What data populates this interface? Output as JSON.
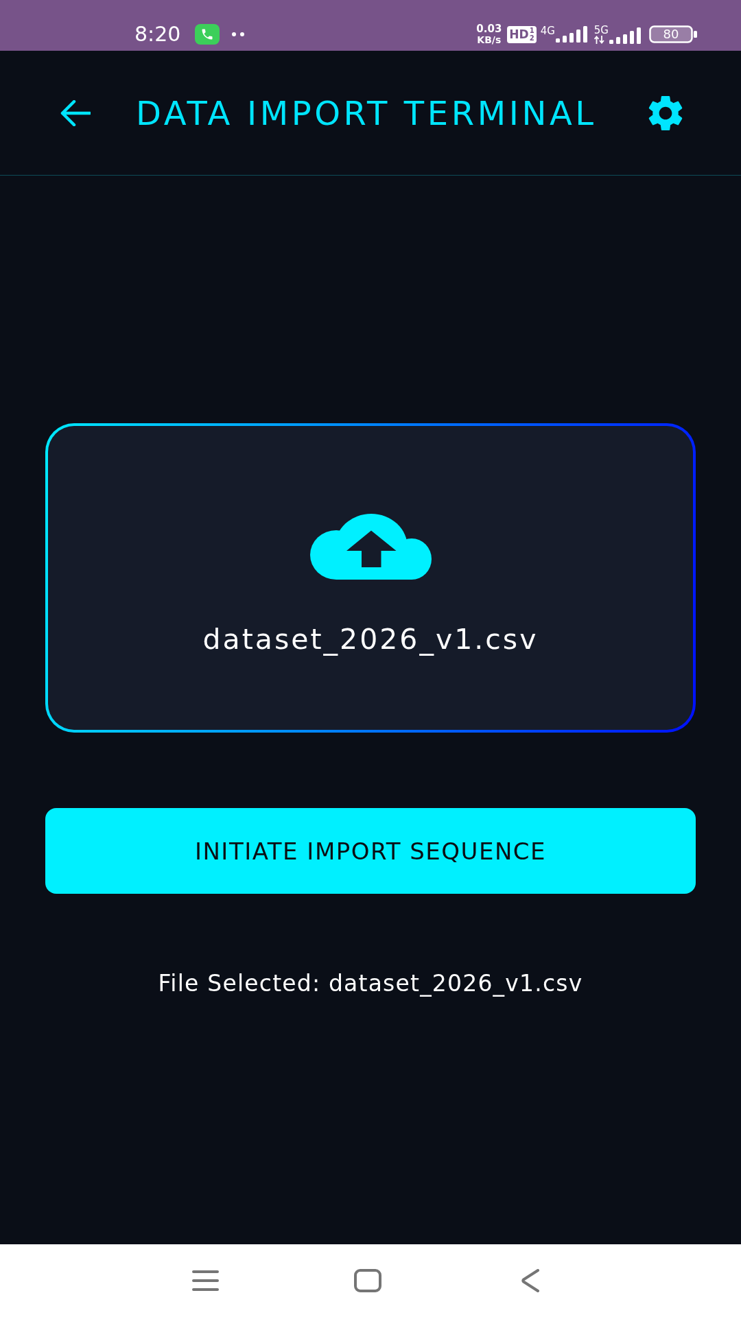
{
  "status_bar": {
    "time": "8:20",
    "network_speed": {
      "value": "0.03",
      "unit": "KB/s"
    },
    "hd_badge": {
      "label": "HD",
      "sims": [
        "1",
        "2"
      ]
    },
    "signals": [
      {
        "label": "4G",
        "kind": "plain"
      },
      {
        "label": "5G",
        "kind": "activity"
      }
    ],
    "battery": "80"
  },
  "app_bar": {
    "title": "DATA IMPORT TERMINAL"
  },
  "upload_card": {
    "file_name": "dataset_2026_v1.csv"
  },
  "import_button": {
    "label": "INITIATE IMPORT SEQUENCE"
  },
  "status_message": "File Selected: dataset_2026_v1.csv"
}
